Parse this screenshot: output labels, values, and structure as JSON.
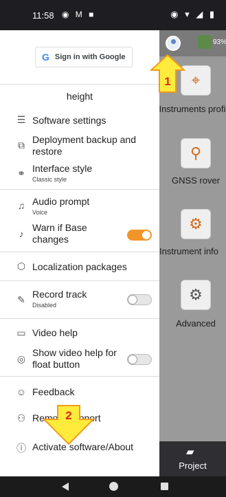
{
  "status": {
    "time": "11:58",
    "left_icons": "◉ M ■",
    "right_icons": "◉ ▾ ◢ ▮"
  },
  "drawer": {
    "signin_label": "Sign in with Google",
    "heading": "height",
    "items": [
      {
        "label": "Software settings",
        "icon": "sliders-icon"
      },
      {
        "label": "Deployment backup and restore",
        "icon": "backup-icon"
      },
      {
        "label": "Interface style",
        "sub": "Classic style",
        "icon": "style-icon"
      },
      {
        "label": "Audio prompt",
        "sub": "Voice",
        "icon": "microphone-icon"
      },
      {
        "label": "Warn if Base changes",
        "icon": "bell-icon",
        "toggle": true
      },
      {
        "label": "Localization packages",
        "icon": "package-icon"
      },
      {
        "label": "Record track",
        "sub": "Disabled",
        "icon": "pencil-icon",
        "toggle": false
      },
      {
        "label": "Video help",
        "icon": "video-icon"
      },
      {
        "label": "Show video help for float button",
        "icon": "eye-icon",
        "toggle": false
      },
      {
        "label": "Feedback",
        "icon": "feedback-icon"
      },
      {
        "label": "Remote support",
        "icon": "remote-icon"
      },
      {
        "label": "Activate software/About",
        "icon": "info-icon"
      }
    ]
  },
  "right_panel": {
    "battery": "93%",
    "tiles": [
      {
        "label": "Instruments profile"
      },
      {
        "label": "GNSS rover"
      },
      {
        "label": "Instrument info"
      },
      {
        "label": "Advanced"
      }
    ],
    "project_label": "Project"
  },
  "callouts": [
    "1",
    "2"
  ],
  "colors": {
    "accent": "#f2942a",
    "callout_fill": "#ffeb3b",
    "callout_stroke": "#f09a1f",
    "callout_text": "#e0261b"
  }
}
